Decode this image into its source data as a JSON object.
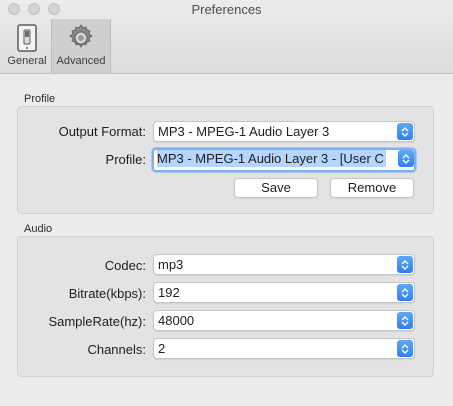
{
  "window": {
    "title": "Preferences"
  },
  "toolbar": {
    "general_label": "General",
    "advanced_label": "Advanced"
  },
  "profile_group": {
    "label": "Profile",
    "output_format_label": "Output Format:",
    "output_format_value": "MP3 - MPEG-1 Audio Layer 3",
    "profile_label": "Profile:",
    "profile_value": "MP3 - MPEG-1 Audio Layer 3 - [User C",
    "save_label": "Save",
    "remove_label": "Remove"
  },
  "audio_group": {
    "label": "Audio",
    "codec_label": "Codec:",
    "codec_value": "mp3",
    "bitrate_label": "Bitrate(kbps):",
    "bitrate_value": "192",
    "samplerate_label": "SampleRate(hz):",
    "samplerate_value": "48000",
    "channels_label": "Channels:",
    "channels_value": "2"
  },
  "colors": {
    "accent": "#2f7ff3",
    "selection": "#b4d5ff",
    "window_bg": "#ececec"
  },
  "icons": {
    "general": "switch-icon",
    "advanced": "gear-icon",
    "dropdown": "chevron-updown-icon"
  }
}
